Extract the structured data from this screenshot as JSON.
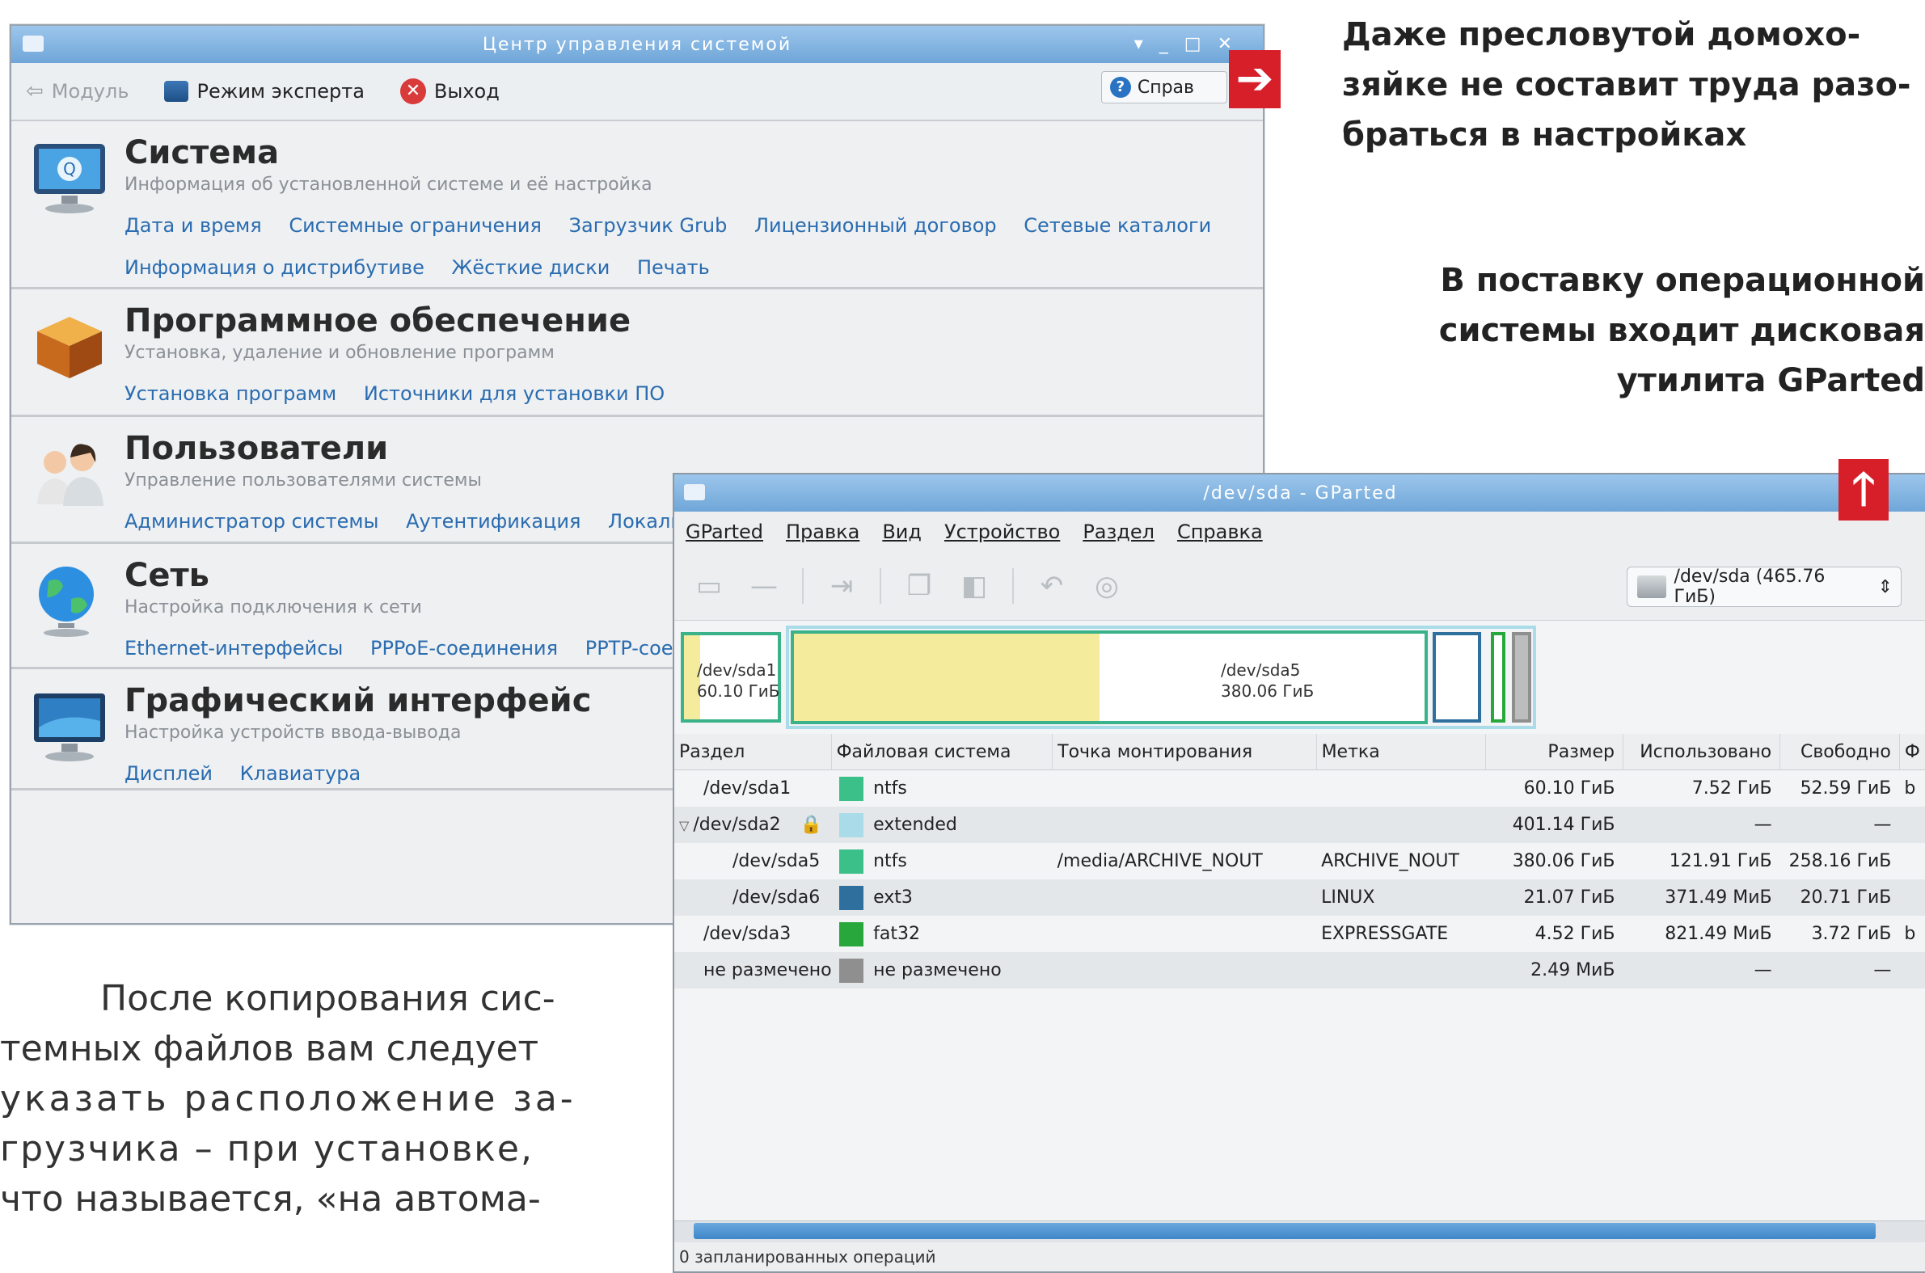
{
  "control_center": {
    "title": "Центр управления системой",
    "toolbar": {
      "module": "Модуль",
      "expert": "Режим эксперта",
      "exit": "Выход",
      "help": "Справ"
    },
    "categories": [
      {
        "title": "Система",
        "desc": "Информация об установленной системе и её настройка",
        "links": [
          "Дата и время",
          "Системные ограничения",
          "Загрузчик Grub",
          "Лицензионный договор",
          "Сетевые каталоги",
          "Информация о дистрибутиве",
          "Жёсткие диски",
          "Печать"
        ]
      },
      {
        "title": "Программное обеспечение",
        "desc": "Установка, удаление и обновление программ",
        "links": [
          "Установка программ",
          "Источники для установки ПО"
        ]
      },
      {
        "title": "Пользователи",
        "desc": "Управление пользователями системы",
        "links": [
          "Администратор системы",
          "Аутентификация",
          "Локаль"
        ]
      },
      {
        "title": "Сеть",
        "desc": "Настройка подключения к сети",
        "links": [
          "Ethernet-интерфейсы",
          "PPPoE-соединения",
          "PPTP-сое"
        ]
      },
      {
        "title": "Графический интерфейс",
        "desc": "Настройка устройств ввода-вывода",
        "links": [
          "Дисплей",
          "Клавиатура"
        ]
      }
    ]
  },
  "gparted": {
    "title": "/dev/sda - GParted",
    "menu": [
      "GParted",
      "Правка",
      "Вид",
      "Устройство",
      "Раздел",
      "Справка"
    ],
    "device": "/dev/sda (465.76 ГиБ)",
    "map": {
      "sda1": {
        "name": "/dev/sda1",
        "size": "60.10 ГиБ"
      },
      "sda5": {
        "name": "/dev/sda5",
        "size": "380.06 ГиБ"
      }
    },
    "columns": [
      "Раздел",
      "Файловая система",
      "Точка монтирования",
      "Метка",
      "Размер",
      "Использовано",
      "Свободно",
      "Ф"
    ],
    "rows": [
      {
        "partition": "/dev/sda1",
        "fs": "ntfs",
        "mount": "",
        "label": "",
        "size": "60.10 ГиБ",
        "used": "7.52 ГиБ",
        "free": "52.59 ГиБ",
        "flags": "b",
        "color": "#3cc08a"
      },
      {
        "partition": "/dev/sda2",
        "fs": "extended",
        "mount": "",
        "label": "",
        "size": "401.14 ГиБ",
        "used": "—",
        "free": "—",
        "flags": "",
        "color": "#a9dce8"
      },
      {
        "partition": "/dev/sda5",
        "fs": "ntfs",
        "mount": "/media/ARCHIVE_NOUT",
        "label": "ARCHIVE_NOUT",
        "size": "380.06 ГиБ",
        "used": "121.91 ГиБ",
        "free": "258.16 ГиБ",
        "flags": "",
        "color": "#3cc08a"
      },
      {
        "partition": "/dev/sda6",
        "fs": "ext3",
        "mount": "",
        "label": "LINUX",
        "size": "21.07 ГиБ",
        "used": "371.49 МиБ",
        "free": "20.71 ГиБ",
        "flags": "",
        "color": "#2e6f9e"
      },
      {
        "partition": "/dev/sda3",
        "fs": "fat32",
        "mount": "",
        "label": "EXPRESSGATE",
        "size": "4.52 ГиБ",
        "used": "821.49 МиБ",
        "free": "3.72 ГиБ",
        "flags": "b",
        "color": "#28a83c"
      },
      {
        "partition": "не размечено",
        "fs": "не размечено",
        "mount": "",
        "label": "",
        "size": "2.49 МиБ",
        "used": "—",
        "free": "—",
        "flags": "",
        "color": "#8f8f8f"
      }
    ],
    "status": "0 запланированных операций"
  },
  "captions": {
    "top": [
      "Даже пресловутой домохо-",
      "зяйке не составит труда разо-",
      "браться в настройках"
    ],
    "middle": [
      "В поставку операционной",
      "системы входит дисковая",
      "утилита GParted"
    ]
  },
  "body_text": [
    "После копирования сис-",
    "темных файлов вам следует",
    "указать расположение за-",
    "грузчика – при установке,",
    "что называется, «на автома-"
  ],
  "accent": "#d71f2a"
}
